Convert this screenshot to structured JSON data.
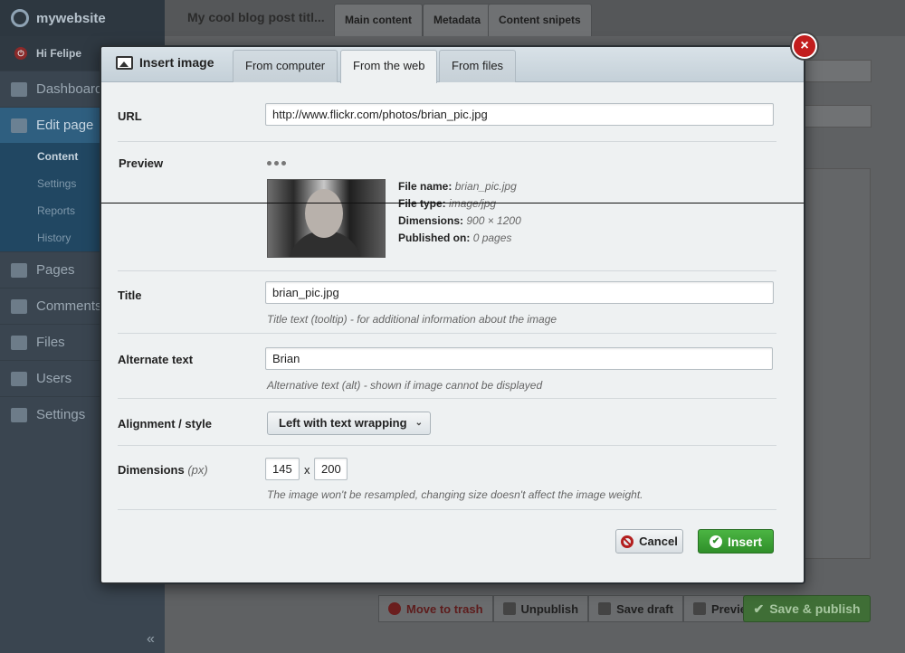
{
  "brand": "mywebsite",
  "user": {
    "greeting": "Hi Felipe"
  },
  "sidebar": {
    "items": [
      {
        "label": "Dashboard",
        "icon": "home-icon"
      },
      {
        "label": "Edit page",
        "icon": "pencil-icon"
      },
      {
        "label": "Pages",
        "icon": "sitemap-icon"
      },
      {
        "label": "Comments",
        "icon": "comment-icon"
      },
      {
        "label": "Files",
        "icon": "image-icon"
      },
      {
        "label": "Users",
        "icon": "users-icon"
      },
      {
        "label": "Settings",
        "icon": "gear-icon"
      }
    ],
    "sub_items": [
      "Content",
      "Settings",
      "Reports",
      "History"
    ],
    "collapse": "«"
  },
  "page": {
    "title": "My cool blog post titl...",
    "tabs": [
      "Main content",
      "Metadata",
      "Content snipets"
    ]
  },
  "bottom_actions": {
    "trash": "Move to trash",
    "unpublish": "Unpublish",
    "save_draft": "Save draft",
    "preview": "Preview",
    "save_publish": "Save & publish"
  },
  "modal": {
    "title": "Insert image",
    "close": "×",
    "tabs": [
      "From computer",
      "From the web",
      "From files"
    ],
    "active_tab": "From the web",
    "url": {
      "label": "URL",
      "value": "http://www.flickr.com/photos/brian_pic.jpg"
    },
    "preview": {
      "label": "Preview",
      "file_name_label": "File name:",
      "file_name": "brian_pic.jpg",
      "file_type_label": "File type:",
      "file_type": "image/jpg",
      "dimensions_label": "Dimensions:",
      "dimensions": "900 × 1200",
      "published_label": "Published on:",
      "published": "0 pages"
    },
    "title_field": {
      "label": "Title",
      "value": "brian_pic.jpg",
      "hint": "Title text (tooltip) - for additional information about the image"
    },
    "alt_field": {
      "label": "Alternate text",
      "value": "Brian",
      "hint": "Alternative text (alt) - shown if image cannot be displayed"
    },
    "alignment": {
      "label": "Alignment / style",
      "value": "Left with text wrapping"
    },
    "dimensions": {
      "label": "Dimensions",
      "unit": "(px)",
      "width": "145",
      "x": "x",
      "height": "200",
      "hint": "The image won't be resampled, changing size doesn't affect the image weight."
    },
    "cancel": "Cancel",
    "insert": "Insert"
  },
  "colors": {
    "insert_green": "#3aa234",
    "close_red": "#c21d1d",
    "sidebar": "#3a4550"
  }
}
